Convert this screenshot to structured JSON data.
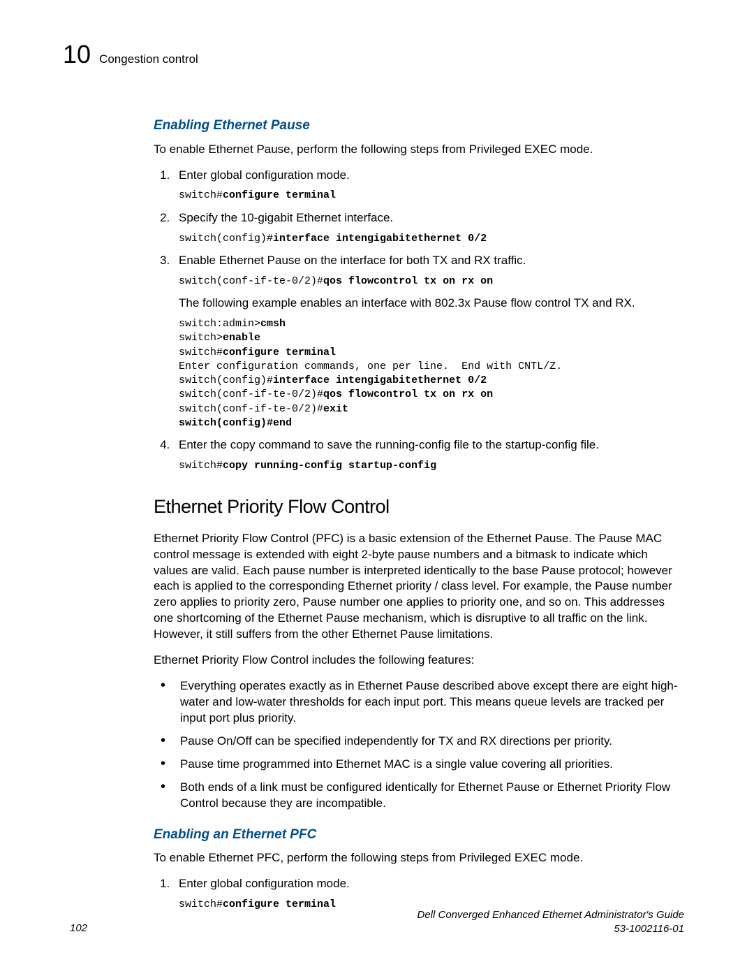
{
  "header": {
    "chapter_number": "10",
    "chapter_title": "Congestion control"
  },
  "section_pause": {
    "subheading": "Enabling Ethernet Pause",
    "intro": "To enable Ethernet Pause, perform the following steps from Privileged EXEC mode.",
    "steps": {
      "s1": {
        "text": "Enter global configuration mode.",
        "code_plain": "switch#",
        "code_bold": "configure terminal"
      },
      "s2": {
        "text": "Specify the 10-gigabit Ethernet interface.",
        "code_plain": "switch(config)#",
        "code_bold": "interface intengigabitethernet 0/2"
      },
      "s3": {
        "text": "Enable Ethernet Pause on the interface for both TX and RX traffic.",
        "code_plain": "switch(conf-if-te-0/2)#",
        "code_bold": "qos flowcontrol tx on rx on",
        "after": "The following example enables an interface with 802.3x Pause flow control TX and RX.",
        "example": {
          "l1p": "switch:admin>",
          "l1b": "cmsh",
          "l2p": "switch>",
          "l2b": "enable",
          "l3p": "switch#",
          "l3b": "configure terminal",
          "l4": "Enter configuration commands, one per line.  End with CNTL/Z.",
          "l5p": "switch(config)#",
          "l5b": "interface intengigabitethernet 0/2",
          "l6p": "switch(conf-if-te-0/2)#",
          "l6b": "qos flowcontrol tx on rx on",
          "l7p": "switch(conf-if-te-0/2)#",
          "l7b": "exit",
          "l8b": "switch(config)#end"
        }
      },
      "s4": {
        "text": "Enter the copy command to save the running-config file to the startup-config file.",
        "code_plain": "switch#",
        "code_bold": "copy running-config startup-config"
      }
    }
  },
  "section_pfc": {
    "heading": "Ethernet Priority Flow Control",
    "p1": "Ethernet Priority Flow Control (PFC) is a basic extension of the Ethernet Pause. The Pause MAC control message is extended with eight 2-byte pause numbers and a bitmask to indicate which values are valid. Each pause number is interpreted identically to the base Pause protocol; however each is applied to the corresponding Ethernet priority / class level. For example, the Pause number zero applies to priority zero, Pause number one applies to priority one, and so on. This addresses one shortcoming of the Ethernet Pause mechanism, which is disruptive to all traffic on the link. However, it still suffers from the other Ethernet Pause limitations.",
    "p2": "Ethernet Priority Flow Control includes the following features:",
    "bullets": {
      "b1": "Everything operates exactly as in Ethernet Pause described above except there are eight high-water and low-water thresholds for each input port. This means queue levels are tracked per input port plus priority.",
      "b2": "Pause On/Off can be specified independently for TX and RX directions per priority.",
      "b3": "Pause time programmed into Ethernet MAC is a single value covering all priorities.",
      "b4": "Both ends of a link must be configured identically for Ethernet Pause or Ethernet Priority Flow Control because they are incompatible."
    },
    "sub2": {
      "subheading": "Enabling an Ethernet PFC",
      "intro": "To enable Ethernet PFC, perform the following steps from Privileged EXEC mode.",
      "s1_text": "Enter global configuration mode.",
      "s1_code_plain": "switch#",
      "s1_code_bold": "configure terminal"
    }
  },
  "footer": {
    "page_number": "102",
    "guide_title": "Dell Converged Enhanced Ethernet Administrator's Guide",
    "doc_number": "53-1002116-01"
  }
}
